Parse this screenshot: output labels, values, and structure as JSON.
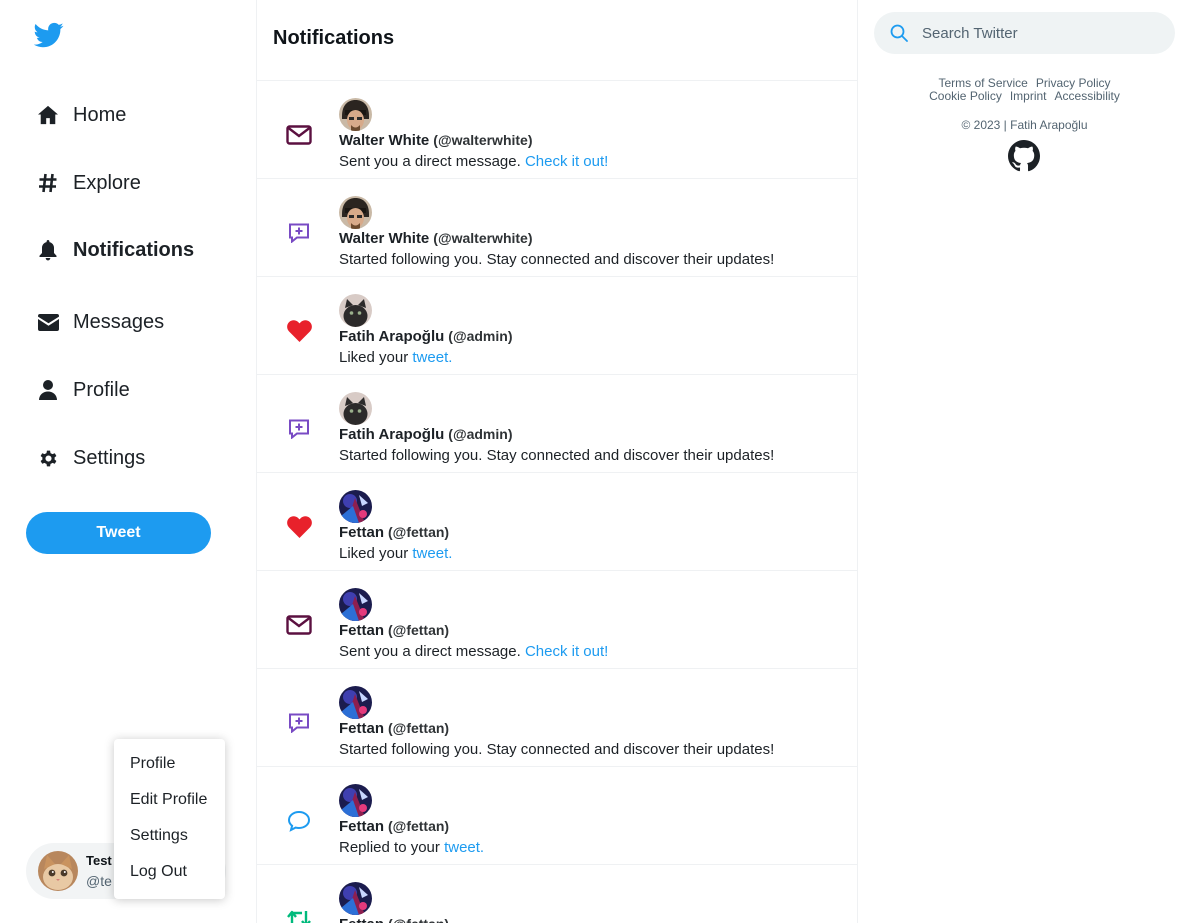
{
  "sidebar": {
    "logo": "twitter-bird-icon",
    "nav": [
      {
        "label": "Home",
        "icon": "home-icon"
      },
      {
        "label": "Explore",
        "icon": "hashtag-icon"
      },
      {
        "label": "Notifications",
        "icon": "bell-icon",
        "active": true
      },
      {
        "label": "Messages",
        "icon": "envelope-icon"
      },
      {
        "label": "Profile",
        "icon": "user-icon"
      },
      {
        "label": "Settings",
        "icon": "gear-icon"
      }
    ],
    "tweet_button": "Tweet",
    "account": {
      "name": "Test",
      "handle": "@te"
    },
    "menu": [
      "Profile",
      "Edit Profile",
      "Settings",
      "Log Out"
    ]
  },
  "main": {
    "title": "Notifications",
    "notifications": [
      {
        "type": "message",
        "icon": "envelope-outline-icon",
        "name": "Walter White",
        "handle": "(@walterwhite)",
        "text": "Sent you a direct message.",
        "link": "Check it out!"
      },
      {
        "type": "follow",
        "icon": "follow-plus-icon",
        "name": "Walter White",
        "handle": "(@walterwhite)",
        "text": "Started following you. Stay connected and discover their updates!",
        "link": ""
      },
      {
        "type": "like",
        "icon": "heart-icon",
        "name": "Fatih Arapoğlu",
        "handle": "(@admin)",
        "text": "Liked your",
        "link": "tweet."
      },
      {
        "type": "follow",
        "icon": "follow-plus-icon",
        "name": "Fatih Arapoğlu",
        "handle": "(@admin)",
        "text": "Started following you. Stay connected and discover their updates!",
        "link": ""
      },
      {
        "type": "like",
        "icon": "heart-icon",
        "name": "Fettan",
        "handle": "(@fettan)",
        "text": "Liked your",
        "link": "tweet."
      },
      {
        "type": "message",
        "icon": "envelope-outline-icon",
        "name": "Fettan",
        "handle": "(@fettan)",
        "text": "Sent you a direct message.",
        "link": "Check it out!"
      },
      {
        "type": "follow",
        "icon": "follow-plus-icon",
        "name": "Fettan",
        "handle": "(@fettan)",
        "text": "Started following you. Stay connected and discover their updates!",
        "link": ""
      },
      {
        "type": "reply",
        "icon": "comment-icon",
        "name": "Fettan",
        "handle": "(@fettan)",
        "text": "Replied to your",
        "link": "tweet."
      },
      {
        "type": "retweet",
        "icon": "retweet-icon",
        "name": "Fettan",
        "handle": "(@fettan)",
        "text": "",
        "link": ""
      }
    ]
  },
  "right": {
    "search_placeholder": "Search Twitter",
    "footer_links": [
      "Terms of Service",
      "Privacy Policy",
      "Cookie Policy",
      "Imprint",
      "Accessibility"
    ],
    "copyright": "© 2023 | Fatih Arapoğlu",
    "github": "github-icon"
  },
  "colors": {
    "accent": "#1d9bf0",
    "like": "#f91880",
    "heart_red": "#e8212b",
    "purple": "#794bc4",
    "retweet_green": "#00ba7c",
    "message_icon": "#5b1040"
  }
}
